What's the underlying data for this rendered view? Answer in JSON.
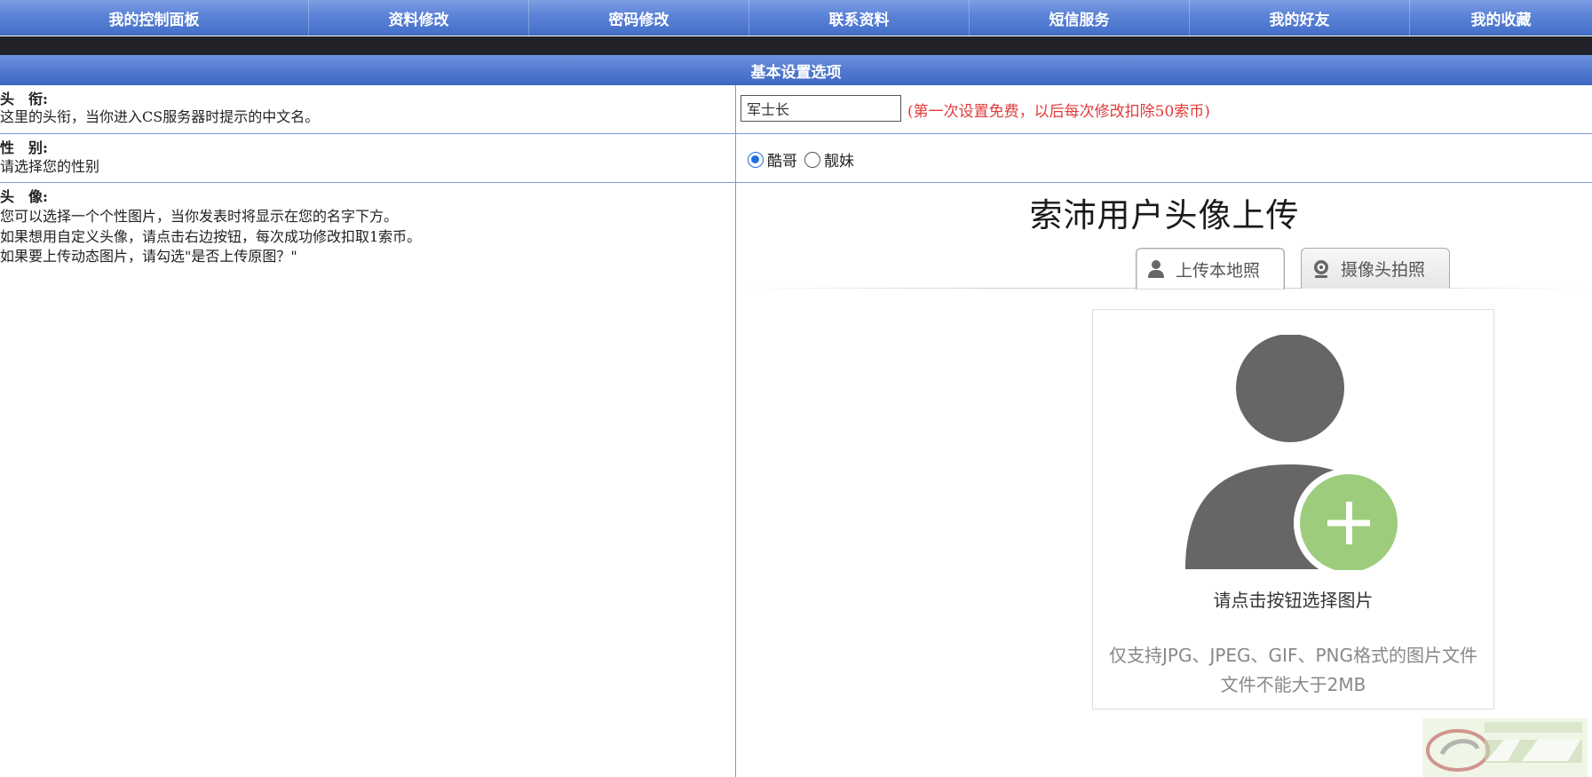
{
  "nav": {
    "items": [
      "我的控制面板",
      "资料修改",
      "密码修改",
      "联系资料",
      "短信服务",
      "我的好友",
      "我的收藏"
    ]
  },
  "section": {
    "title": "基本设置选项"
  },
  "title_row": {
    "label": "头　衔:",
    "desc": "这里的头衔，当你进入CS服务器时提示的中文名。",
    "input_value": "军士长",
    "note": "(第一次设置免费，以后每次修改扣除50索币)"
  },
  "gender_row": {
    "label": "性　别:",
    "desc": "请选择您的性别",
    "options": [
      {
        "label": "酷哥",
        "checked": true
      },
      {
        "label": "靓妹",
        "checked": false
      }
    ]
  },
  "avatar_row": {
    "label": "头　像:",
    "desc_lines": [
      "您可以选择一个个性图片，当你发表时将显示在您的名字下方。",
      "如果想用自定义头像，请点击右边按钮，每次成功修改扣取1索币。",
      "如果要上传动态图片，请勾选\"是否上传原图？\""
    ]
  },
  "uploader": {
    "title": "索沛用户头像上传",
    "tabs": [
      {
        "label": "上传本地照",
        "icon": "user-icon",
        "active": true
      },
      {
        "label": "摄像头拍照",
        "icon": "webcam-icon",
        "active": false
      }
    ],
    "choose_text": "请点击按钮选择图片",
    "support_line1": "仅支持JPG、JPEG、GIF、PNG格式的图片文件",
    "support_line2": "文件不能大于2MB"
  },
  "colors": {
    "nav_blue": "#5a82d6",
    "dark_bar": "#222328",
    "note_red": "#e23a3a",
    "plus_green": "#9dcd7c",
    "avatar_gray": "#666666"
  }
}
